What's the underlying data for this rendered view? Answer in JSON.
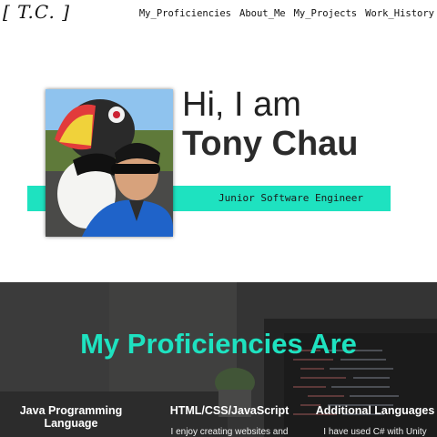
{
  "header": {
    "logo": "[ T.C. ]",
    "nav": [
      "My_Proficiencies",
      "About_Me",
      "My_Projects",
      "Work_History"
    ]
  },
  "hero": {
    "greeting": "Hi, I am",
    "name": "Tony Chau",
    "role": "Junior Software Engineer"
  },
  "proficiencies": {
    "title": "My Proficiencies Are",
    "items": [
      {
        "heading": "Java Programming Language",
        "text": ""
      },
      {
        "heading": "HTML/CSS/JavaScript",
        "text": "I enjoy creating websites and"
      },
      {
        "heading": "Additional Languages",
        "text": "I have used C# with Unity"
      }
    ]
  },
  "colors": {
    "accent": "#1ee2c0",
    "text": "#222222"
  }
}
